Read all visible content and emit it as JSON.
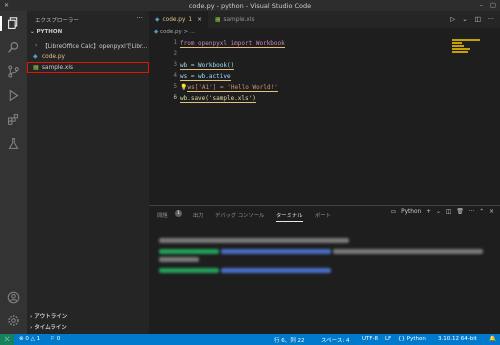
{
  "window": {
    "title": "code.py - python - Visual Studio Code"
  },
  "sidebar": {
    "title": "エクスプローラー",
    "section": "PYTHON",
    "items": [
      {
        "label": "【LibreOffice Calc】openpyxlでLibr...",
        "icon": "chevron-right-icon"
      },
      {
        "label": "code.py",
        "icon": "python-file-icon"
      },
      {
        "label": "sample.xls",
        "icon": "spreadsheet-file-icon"
      }
    ],
    "outline": "アウトライン",
    "timeline": "タイムライン"
  },
  "tabs": [
    {
      "label": "code.py",
      "badge": "1",
      "icon": "python-file-icon",
      "active": true
    },
    {
      "label": "sample.xls",
      "icon": "spreadsheet-file-icon",
      "active": false
    }
  ],
  "breadcrumb": "code.py > ...",
  "editor": {
    "lines": [
      {
        "number": "1",
        "text": "from openpyxl import Workbook"
      },
      {
        "number": "2",
        "text": ""
      },
      {
        "number": "3",
        "text": "wb = Workbook()"
      },
      {
        "number": "4",
        "text": "ws = wb.active"
      },
      {
        "number": "5",
        "text": "ws['A1'] = 'Hello World!'"
      },
      {
        "number": "6",
        "text": "wb.save('sample.xls')"
      }
    ]
  },
  "panel": {
    "tabs": [
      "問題",
      "出力",
      "デバッグ コンソール",
      "ターミナル",
      "ポート"
    ],
    "problems_badge": "1",
    "active_tab": "ターミナル",
    "terminal_profile": "Python"
  },
  "statusbar": {
    "errors": "0",
    "warnings": "1",
    "info": "0",
    "position": "行 6、列 22",
    "spaces": "スペース: 4",
    "encoding": "UTF-8",
    "eol": "LF",
    "language": "Python",
    "interpreter": "3.10.12 64-bit"
  },
  "colors": {
    "accent": "#007acc",
    "remote": "#16825d",
    "selection_outline": "#e51400"
  }
}
